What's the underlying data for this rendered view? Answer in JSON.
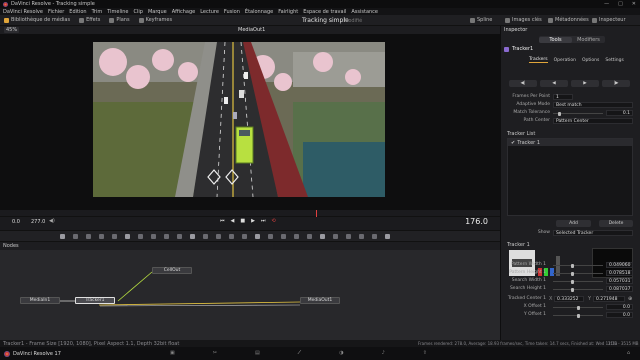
{
  "window": {
    "title": "DaVinci Resolve - Tracking simple"
  },
  "menu": [
    "DaVinci Resolve",
    "Fichier",
    "Edition",
    "Trim",
    "Timeline",
    "Clip",
    "Marque",
    "Affichage",
    "Lecture",
    "Fusion",
    "Étalonnage",
    "Fairlight",
    "Espace de travail",
    "Assistance"
  ],
  "toolbar": {
    "media_library": "Bibliothèque de médias",
    "effects": "Effets",
    "clips": "Plans",
    "keyframes": "Keyframes",
    "project_title": "Tracking simple",
    "project_status": "Modifié",
    "spline": "Spline",
    "images_cles": "Images clés",
    "metadata": "Métadonnées",
    "inspector": "Inspecteur"
  },
  "viewer": {
    "zoom": "45%",
    "name": "MediaOut1",
    "frame_in": "0.0",
    "frame_out": "277.0",
    "frame_current": "176.0"
  },
  "nodes": {
    "title": "Nodes",
    "items": {
      "mediain": "MediaIn1",
      "tracker": "Tracker1",
      "cellout": "CellOut",
      "mediaout": "MediaOut1"
    }
  },
  "inspector": {
    "title": "Inspector",
    "tabs": [
      "Tools",
      "Modifiers"
    ],
    "node_name": "Tracker1",
    "subtabs": [
      "Trackers",
      "Operation",
      "Options",
      "Settings"
    ],
    "frames_per_point_label": "Frames Per Point",
    "frames_per_point_value": "1",
    "adaptive_mode_label": "Adaptive Mode",
    "adaptive_mode_value": "Best match",
    "match_tolerance_label": "Match Tolerance",
    "match_tolerance_value": "0.1",
    "path_center_label": "Path Center",
    "path_center_value": "Pattern Center",
    "tracker_list_label": "Tracker List",
    "tracker_list_item": "Tracker 1",
    "add_label": "Add",
    "delete_label": "Delete",
    "show_label": "Show",
    "show_value": "Selected Tracker",
    "tracker_section": "Tracker 1",
    "params": [
      {
        "label": "Pattern Width 1",
        "value": "0.049060"
      },
      {
        "label": "Pattern Height 1",
        "value": "0.078518"
      },
      {
        "label": "Search Width 1",
        "value": "0.057031"
      },
      {
        "label": "Search Height 1",
        "value": "0.087037"
      }
    ],
    "tracked_center_label": "Tracked Center 1",
    "tracked_center_x": "0.333252",
    "tracked_center_y": "0.271948",
    "x_offset_label": "X Offset 1",
    "x_offset_value": "0.0",
    "y_offset_label": "Y Offset 1",
    "y_offset_value": "0.0"
  },
  "status": {
    "left": "Tracker1 - Frame Size [1920, 1080], Pixel Aspect 1.1, Depth 32bit float",
    "right": "Frames rendered: 278.0,  Average: 18.93 frames/sec,  Time taken: 14.7 secs,  Finished at: Wed 12:13",
    "zoom": "11% - 3515 MB"
  },
  "pagebar": {
    "app": "DaVinci Resolve 17"
  },
  "colors": {
    "accent": "#e0a53a",
    "playhead": "#e04040",
    "bus": "#9ccc40"
  }
}
